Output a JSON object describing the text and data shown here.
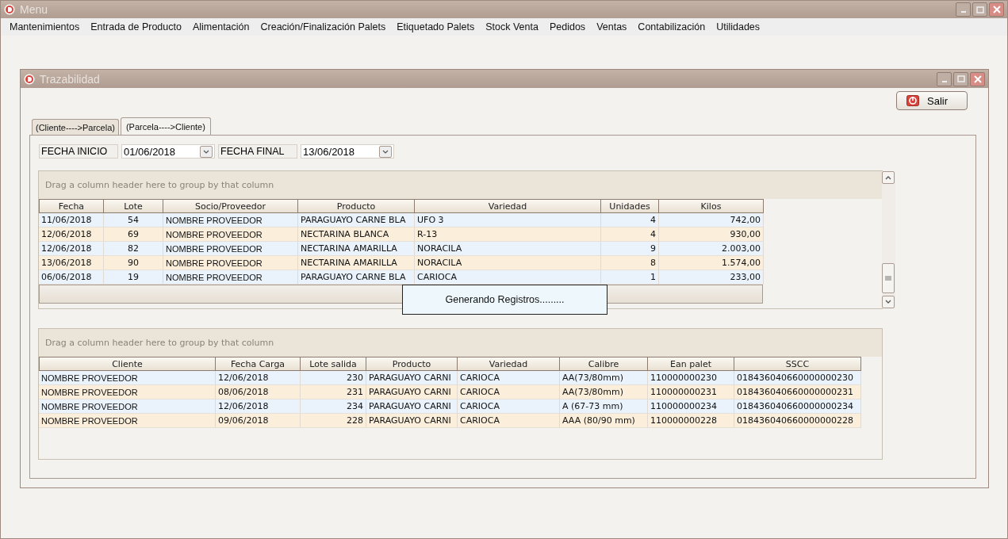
{
  "main_window": {
    "title": "Menu"
  },
  "menu": [
    "Mantenimientos",
    "Entrada de Producto",
    "Alimentación",
    "Creación/Finalización Palets",
    "Etiquetado Palets",
    "Stock Venta",
    "Pedidos",
    "Ventas",
    "Contabilización",
    "Utilidades"
  ],
  "child_window": {
    "title": "Trazabilidad",
    "exit_button": "Salir",
    "tabs": [
      {
        "label": "(Cliente---->Parcela)",
        "selected": false
      },
      {
        "label": "(Parcela---->Cliente)",
        "selected": true
      }
    ],
    "filters": [
      {
        "label": "FECHA INICIO",
        "value": "01/06/2018"
      },
      {
        "label": "FECHA FINAL",
        "value": "13/06/2018"
      }
    ],
    "upper_grid": {
      "group_hint": "Drag a column header here to group by that column",
      "columns": [
        "Fecha",
        "Lote",
        "Socio/Proveedor",
        "Producto",
        "Variedad",
        "Unidades",
        "Kilos"
      ],
      "rows": [
        [
          "11/06/2018",
          "54",
          "NOMBRE PROVEEDOR",
          "PARAGUAYO CARNE BLA",
          "UFO 3",
          "4",
          "742,00"
        ],
        [
          "12/06/2018",
          "69",
          "NOMBRE PROVEEDOR",
          "NECTARINA BLANCA",
          "R-13",
          "4",
          "930,00"
        ],
        [
          "12/06/2018",
          "82",
          "NOMBRE PROVEEDOR",
          "NECTARINA AMARILLA",
          "NORACILA",
          "9",
          "2.003,00"
        ],
        [
          "13/06/2018",
          "90",
          "NOMBRE PROVEEDOR",
          "NECTARINA AMARILLA",
          "NORACILA",
          "8",
          "1.574,00"
        ],
        [
          "06/06/2018",
          "19",
          "NOMBRE PROVEEDOR",
          "PARAGUAYO CARNE BLA",
          "CARIOCA",
          "1",
          "233,00"
        ]
      ]
    },
    "lower_grid": {
      "group_hint": "Drag a column header here to group by that column",
      "columns": [
        "Cliente",
        "Fecha Carga",
        "Lote salida",
        "Producto",
        "Variedad",
        "Calibre",
        "Ean palet",
        "SSCC"
      ],
      "rows": [
        [
          "NOMBRE PROVEEDOR",
          "12/06/2018",
          "230",
          "PARAGUAYO CARNI",
          "CARIOCA",
          "AA(73/80mm)",
          "110000000230",
          "018436040660000000230"
        ],
        [
          "NOMBRE PROVEEDOR",
          "08/06/2018",
          "231",
          "PARAGUAYO CARNI",
          "CARIOCA",
          "AA(73/80mm)",
          "110000000231",
          "018436040660000000231"
        ],
        [
          "NOMBRE PROVEEDOR",
          "12/06/2018",
          "234",
          "PARAGUAYO CARNI",
          "CARIOCA",
          "A (67-73 mm)",
          "110000000234",
          "018436040660000000234"
        ],
        [
          "NOMBRE PROVEEDOR",
          "09/06/2018",
          "228",
          "PARAGUAYO CARNI",
          "CARIOCA",
          "AAA (80/90 mm)",
          "110000000228",
          "018436040660000000228"
        ]
      ]
    },
    "progress_message": "Generando Registros........."
  }
}
